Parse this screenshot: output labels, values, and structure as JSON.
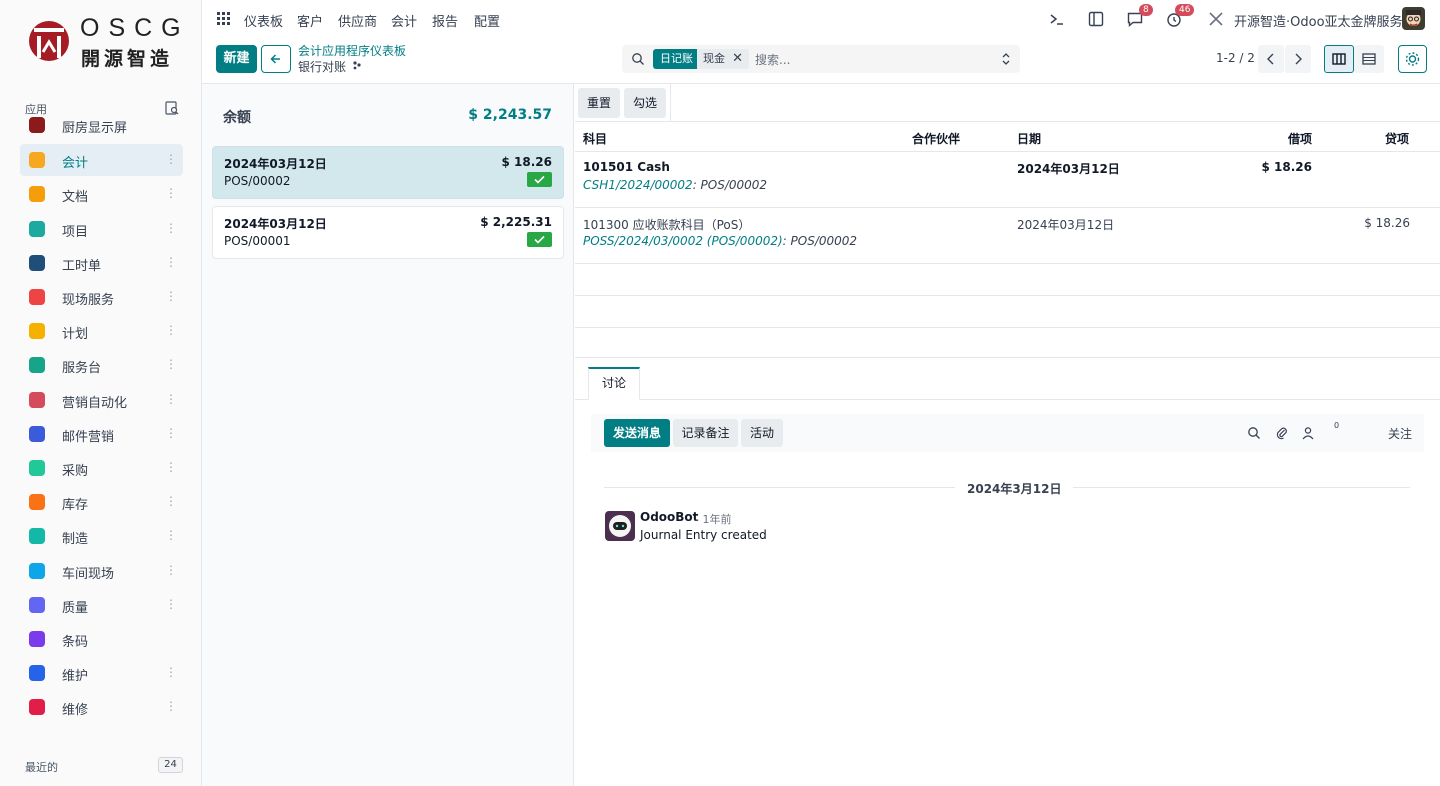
{
  "brand": {
    "name_en": "OSCG",
    "name_zh": "開源智造"
  },
  "sidebar": {
    "apps_label": "应用",
    "recent_label": "最近的",
    "recent_count": "24",
    "items": [
      {
        "label": "厨房显示屏",
        "color": "#8b1a1a"
      },
      {
        "label": "会计",
        "color": "#f6a821"
      },
      {
        "label": "文档",
        "color": "#f59e0b"
      },
      {
        "label": "项目",
        "color": "#1ba9a0"
      },
      {
        "label": "工时单",
        "color": "#1f4e79"
      },
      {
        "label": "现场服务",
        "color": "#ef4444"
      },
      {
        "label": "计划",
        "color": "#f6b100"
      },
      {
        "label": "服务台",
        "color": "#17a589"
      },
      {
        "label": "营销自动化",
        "color": "#d44b5b"
      },
      {
        "label": "邮件营销",
        "color": "#3b5bdb"
      },
      {
        "label": "采购",
        "color": "#20c997"
      },
      {
        "label": "库存",
        "color": "#f97316"
      },
      {
        "label": "制造",
        "color": "#14b8a6"
      },
      {
        "label": "车间现场",
        "color": "#0ea5e9"
      },
      {
        "label": "质量",
        "color": "#6366f1"
      },
      {
        "label": "条码",
        "color": "#7c3aed"
      },
      {
        "label": "维护",
        "color": "#2563eb"
      },
      {
        "label": "维修",
        "color": "#e11d48"
      }
    ]
  },
  "topnav": {
    "menus": [
      "仪表板",
      "客户",
      "供应商",
      "会计",
      "报告",
      "配置"
    ],
    "messages_badge": "8",
    "activities_badge": "46",
    "company": "开源智造·Odoo亚太金牌服务"
  },
  "control": {
    "new_label": "新建",
    "breadcrumb_parent": "会计应用程序仪表板",
    "breadcrumb_current": "银行对账",
    "facet_journal": "日记账",
    "facet_value": "现金",
    "search_placeholder": "搜索...",
    "pager": "1-2 / 2"
  },
  "left": {
    "balance_label": "余额",
    "balance_value": "$ 2,243.57",
    "lines": [
      {
        "date": "2024年03月12日",
        "amount": "$ 18.26",
        "ref": "POS/00002"
      },
      {
        "date": "2024年03月12日",
        "amount": "$ 2,225.31",
        "ref": "POS/00001"
      }
    ]
  },
  "right": {
    "reset_label": "重置",
    "check_label": "勾选",
    "columns": {
      "account": "科目",
      "partner": "合作伙伴",
      "date": "日期",
      "debit": "借项",
      "credit": "贷项"
    },
    "rows": [
      {
        "account": "101501 Cash",
        "date": "2024年03月12日",
        "debit": "$ 18.26",
        "credit": "",
        "link": "CSH1/2024/00002",
        "sub": ": POS/00002"
      },
      {
        "account": "101300 应收账款科目（PoS）",
        "date": "2024年03月12日",
        "debit": "",
        "credit": "$ 18.26",
        "link": "POSS/2024/03/0002 (POS/00002)",
        "sub": ": POS/00002"
      }
    ]
  },
  "chatter": {
    "tab": "讨论",
    "send_message": "发送消息",
    "log_note": "记录备注",
    "activities": "活动",
    "follower_count": "0",
    "follow": "关注",
    "date": "2024年3月12日",
    "author": "OdooBot",
    "time": "- 1年前",
    "message": "Journal Entry created"
  }
}
